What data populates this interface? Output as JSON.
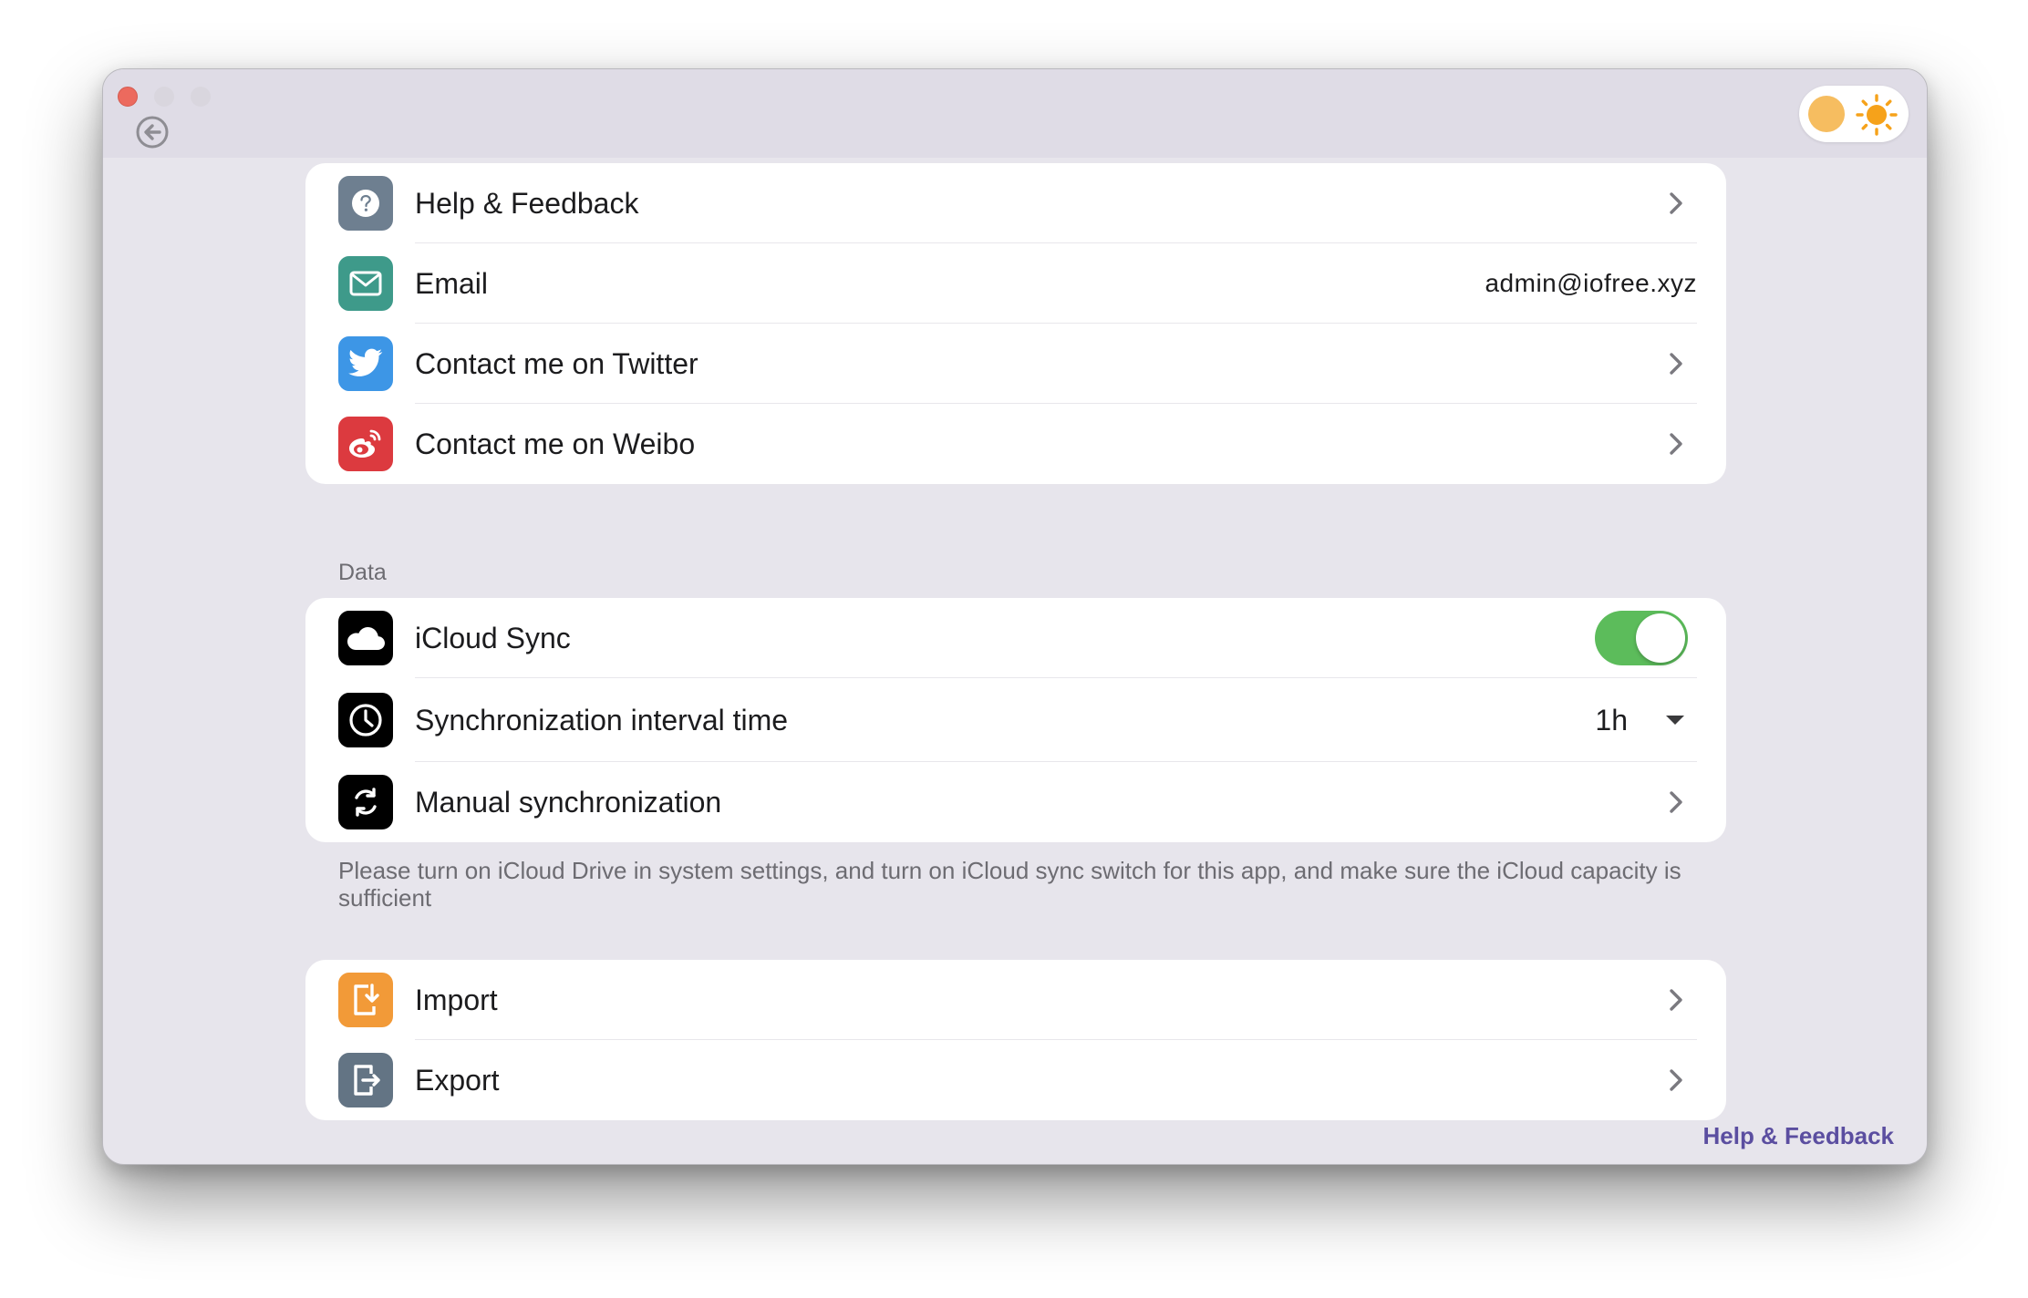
{
  "contact_section": {
    "items": [
      {
        "label": "Help & Feedback",
        "icon": "question-circle-icon"
      },
      {
        "label": "Email",
        "value": "admin@iofree.xyz",
        "icon": "envelope-icon"
      },
      {
        "label": "Contact me on Twitter",
        "icon": "twitter-bird-icon"
      },
      {
        "label": "Contact me on Weibo",
        "icon": "weibo-icon"
      }
    ]
  },
  "data_section": {
    "title": "Data",
    "icloud_sync": {
      "label": "iCloud Sync",
      "enabled": true
    },
    "interval": {
      "label": "Synchronization interval time",
      "value": "1h"
    },
    "manual": {
      "label": "Manual synchronization"
    },
    "footnote": "Please turn on iCloud Drive in system settings, and turn on iCloud sync switch for this app, and make sure the iCloud capacity is sufficient"
  },
  "transfer_section": {
    "import": {
      "label": "Import"
    },
    "export": {
      "label": "Export"
    }
  },
  "footer": {
    "link": "Help & Feedback"
  },
  "colors": {
    "help_icon_bg": "#6e7f90",
    "email_icon_bg": "#3e9a8a",
    "twitter_icon_bg": "#3d96e6",
    "weibo_icon_bg": "#dc3a3f",
    "sync_icon_bg": "#000000",
    "import_icon_bg": "#f29a38",
    "export_icon_bg": "#637484",
    "toggle_on": "#5cbc5b",
    "accent_link": "#5b4ea0"
  }
}
